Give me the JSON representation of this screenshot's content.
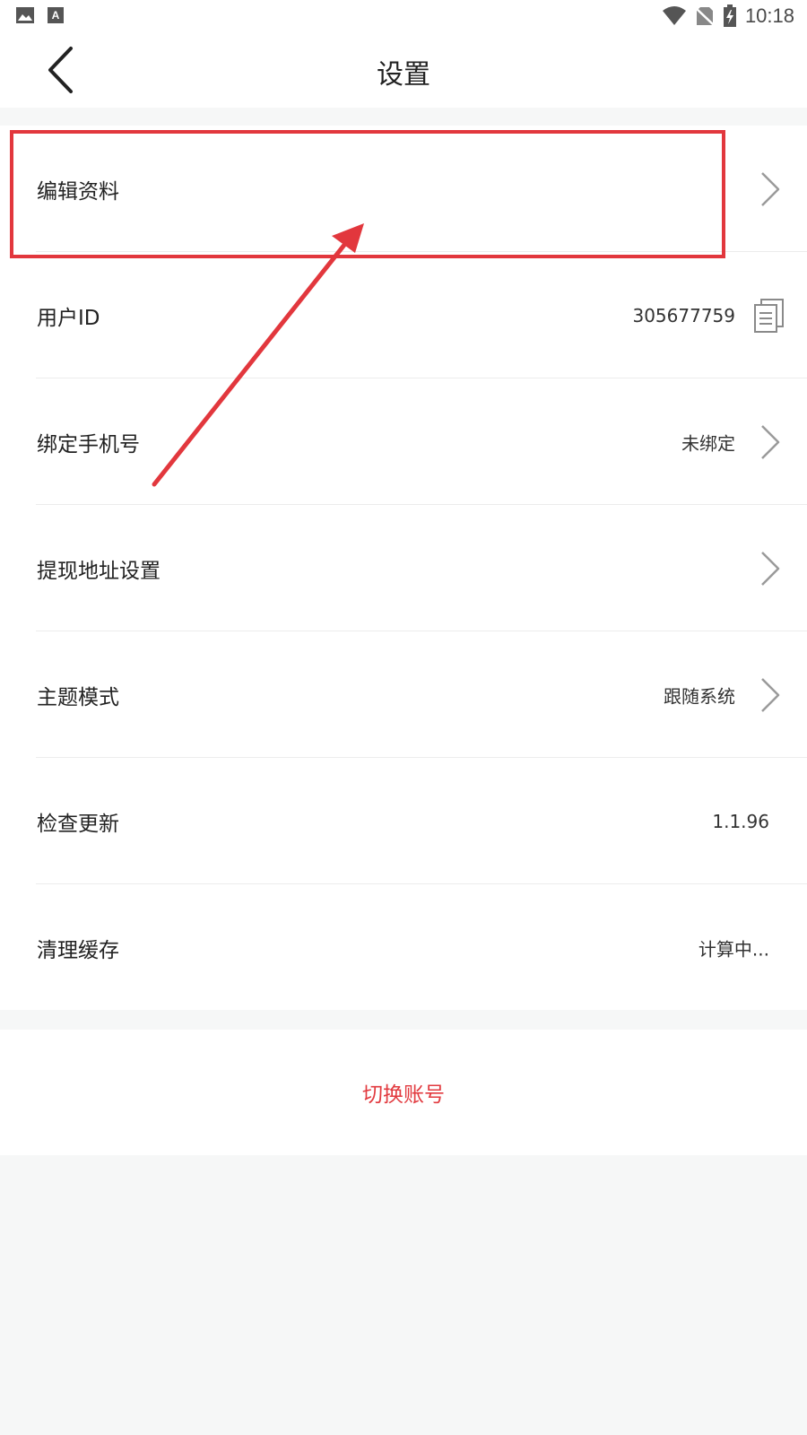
{
  "status_bar": {
    "time": "10:18",
    "icons": [
      "image-icon",
      "text-a-icon",
      "wifi-icon",
      "no-sim-icon",
      "battery-charging-icon"
    ]
  },
  "header": {
    "title": "设置",
    "back_icon": "chevron-left-icon"
  },
  "settings": {
    "items": [
      {
        "label": "编辑资料",
        "value": "",
        "trailing": "chevron-right-icon"
      },
      {
        "label": "用户ID",
        "value": "305677759",
        "trailing": "copy-icon"
      },
      {
        "label": "绑定手机号",
        "value": "未绑定",
        "trailing": "chevron-right-icon"
      },
      {
        "label": "提现地址设置",
        "value": "",
        "trailing": "chevron-right-icon"
      },
      {
        "label": "主题模式",
        "value": "跟随系统",
        "trailing": "chevron-right-icon"
      },
      {
        "label": "检查更新",
        "value": "1.1.96",
        "trailing": ""
      },
      {
        "label": "清理缓存",
        "value": "计算中...",
        "trailing": ""
      }
    ]
  },
  "actions": {
    "switch_account": "切换账号"
  },
  "colors": {
    "accent_red": "#e23a3f",
    "background": "#f6f7f7",
    "surface": "#ffffff",
    "annotation_red": "#e2373d"
  }
}
